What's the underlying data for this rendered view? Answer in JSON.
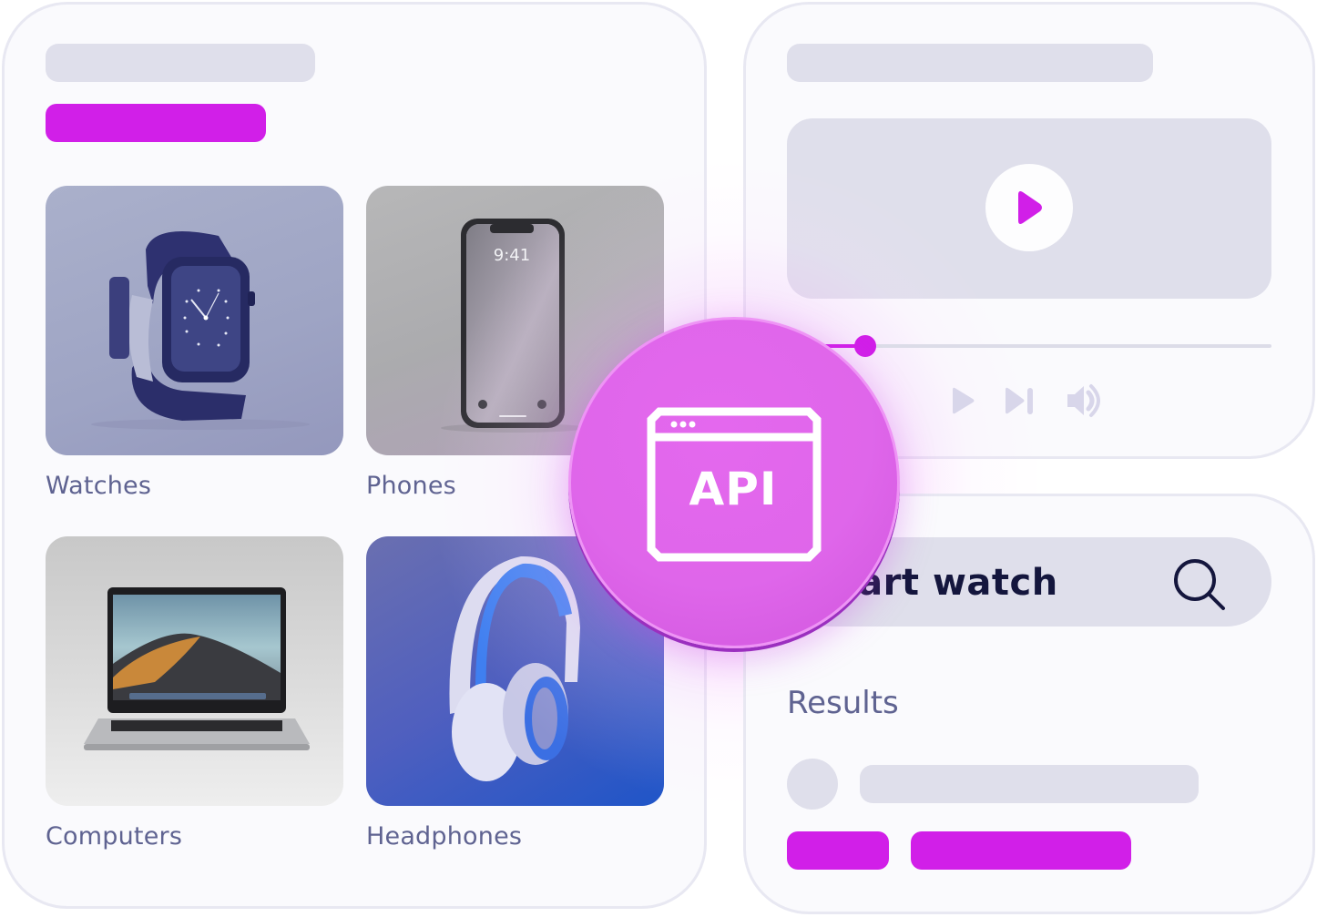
{
  "colors": {
    "accent": "#d11fe8",
    "skeleton": "#dfdfeb",
    "panel_bg": "#fafafd",
    "panel_border": "#e8e8f2",
    "label_text": "#5f6391",
    "search_text": "#14163d",
    "api_badge": "#e066eb"
  },
  "catalog": {
    "categories": [
      {
        "label": "Watches",
        "image": "smartwatch-photo"
      },
      {
        "label": "Phones",
        "image": "smartphone-photo"
      },
      {
        "label": "Computers",
        "image": "laptop-photo"
      },
      {
        "label": "Headphones",
        "image": "headphones-photo"
      }
    ],
    "phone_screen": {
      "time": "9:41"
    }
  },
  "api_badge": {
    "label": "API",
    "icon": "browser-window-icon"
  },
  "video_player": {
    "progress": 0.1,
    "controls": [
      "play-icon",
      "skip-next-icon",
      "volume-icon"
    ]
  },
  "search": {
    "value": "smart watch",
    "visible_value": "mart watch",
    "icon": "search-icon"
  },
  "results": {
    "heading": "Results"
  }
}
